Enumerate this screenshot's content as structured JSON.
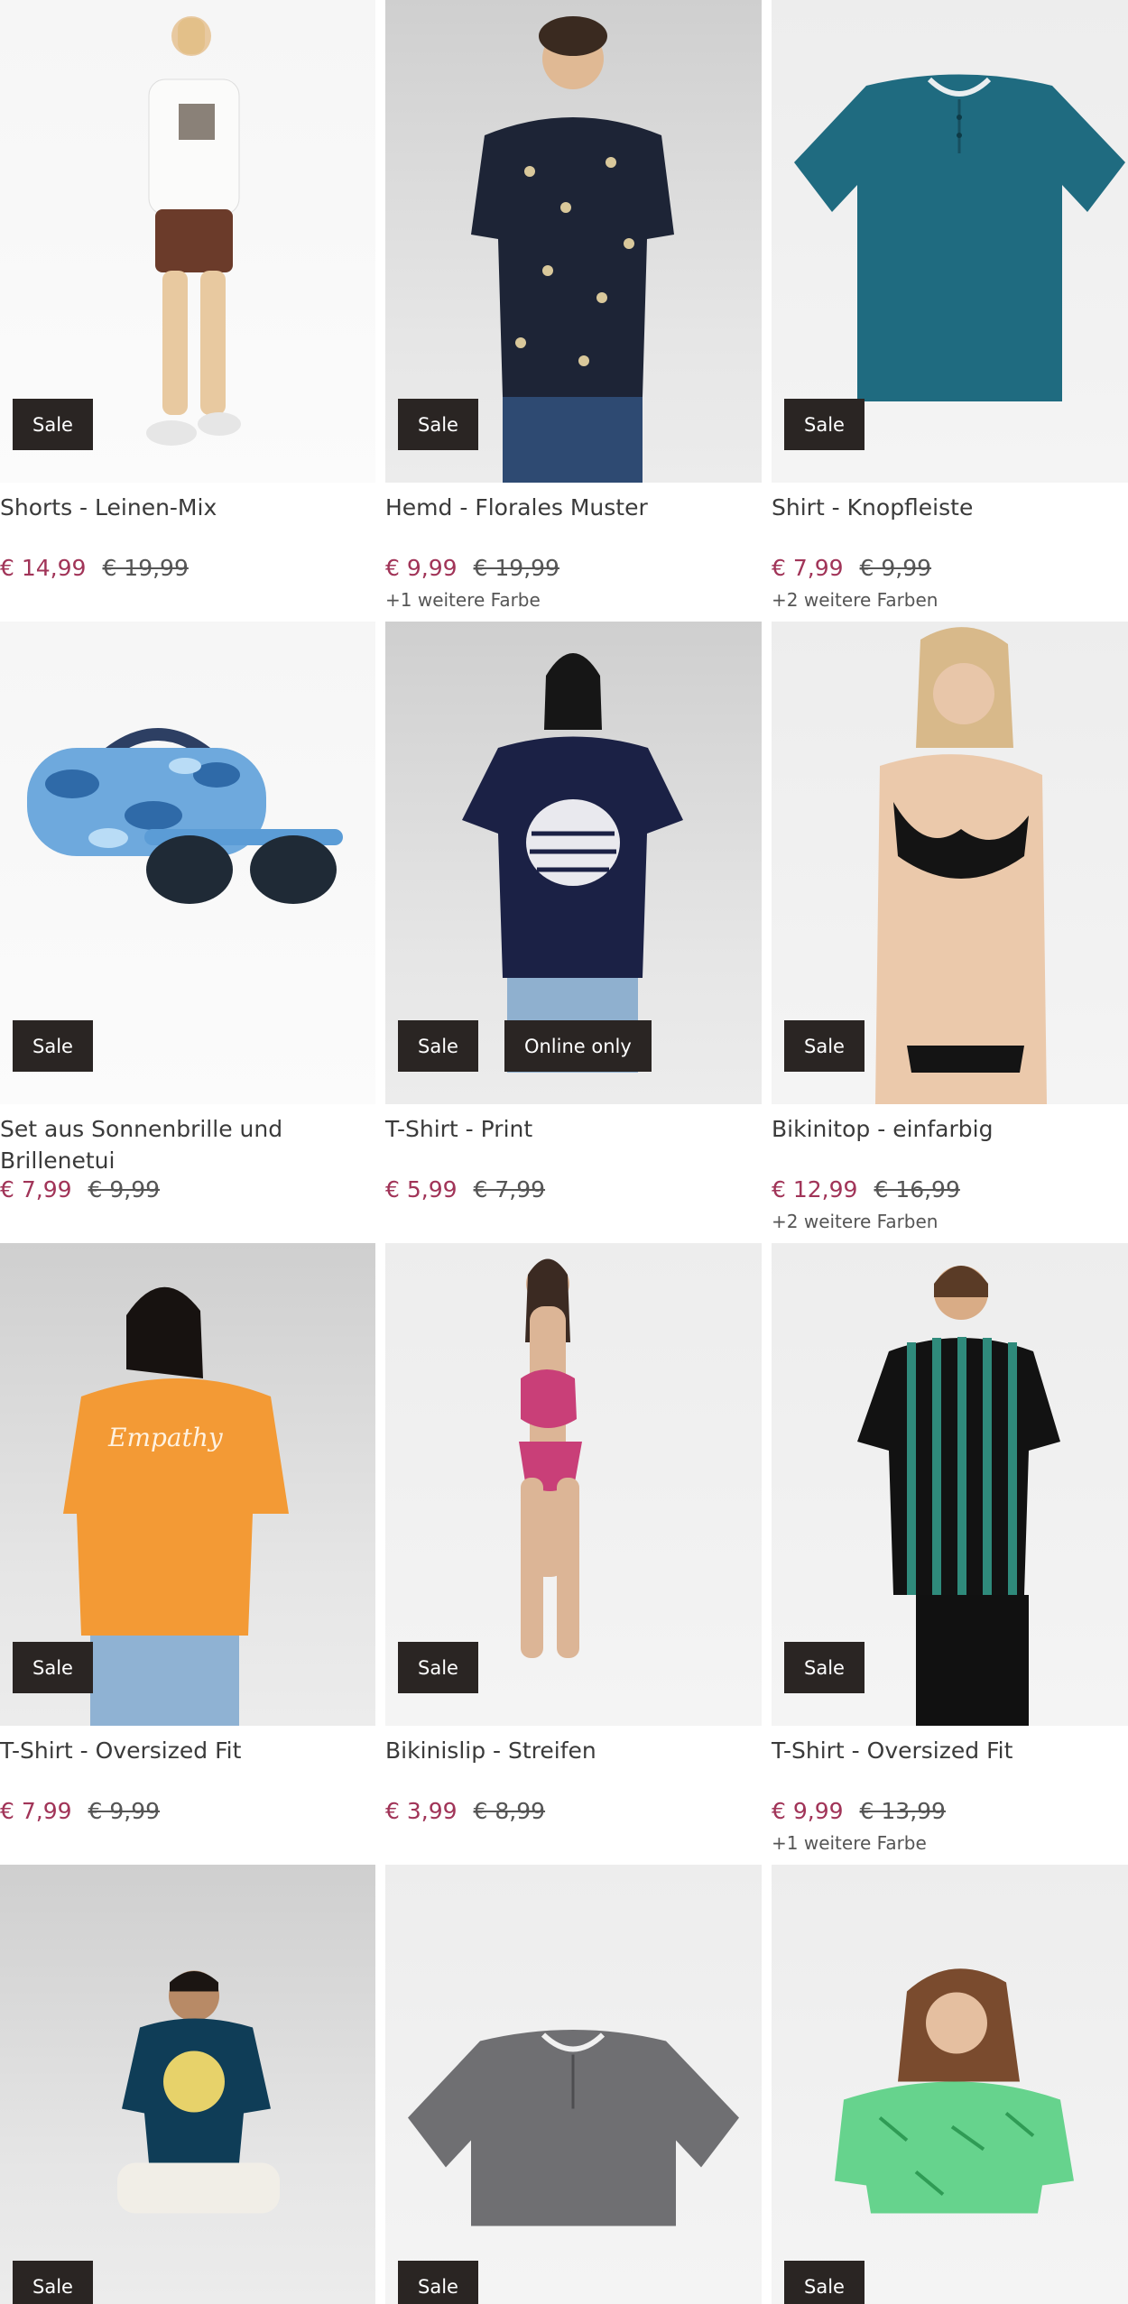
{
  "products": [
    {
      "title": "Shorts - Leinen-Mix",
      "price": "€ 14,99",
      "old_price": "€ 19,99",
      "colors": "",
      "badges": [
        "Sale"
      ],
      "image": "woman-white-tee-brown-shorts"
    },
    {
      "title": "Hemd - Florales Muster",
      "price": "€ 9,99",
      "old_price": "€ 19,99",
      "colors": "+1 weitere Farbe",
      "badges": [
        "Sale"
      ],
      "image": "man-floral-shirt"
    },
    {
      "title": "Shirt - Knopfleiste",
      "price": "€ 7,99",
      "old_price": "€ 9,99",
      "colors": "+2 weitere Farben",
      "badges": [
        "Sale"
      ],
      "image": "teal-henley-shirt"
    },
    {
      "title": "Set aus Sonnenbrille und Brillenetui",
      "price": "€ 7,99",
      "old_price": "€ 9,99",
      "colors": "",
      "badges": [
        "Sale"
      ],
      "image": "camo-sunglasses-case"
    },
    {
      "title": "T-Shirt - Print",
      "price": "€ 5,99",
      "old_price": "€ 7,99",
      "colors": "",
      "badges": [
        "Sale",
        "Online only"
      ],
      "image": "woman-navy-print-tee"
    },
    {
      "title": "Bikinitop - einfarbig",
      "price": "€ 12,99",
      "old_price": "€ 16,99",
      "colors": "+2 weitere Farben",
      "badges": [
        "Sale"
      ],
      "image": "woman-black-bikini"
    },
    {
      "title": "T-Shirt - Oversized Fit",
      "price": "€ 7,99",
      "old_price": "€ 9,99",
      "colors": "",
      "badges": [
        "Sale"
      ],
      "image": "woman-orange-tee"
    },
    {
      "title": "Bikinislip - Streifen",
      "price": "€ 3,99",
      "old_price": "€ 8,99",
      "colors": "",
      "badges": [
        "Sale"
      ],
      "image": "woman-pink-bikini"
    },
    {
      "title": "T-Shirt - Oversized Fit",
      "price": "€ 9,99",
      "old_price": "€ 13,99",
      "colors": "+1 weitere Farbe",
      "badges": [
        "Sale"
      ],
      "image": "man-striped-tee"
    },
    {
      "title": "",
      "price": "",
      "old_price": "",
      "colors": "",
      "badges": [
        "Sale"
      ],
      "image": "man-print-tee-stool"
    },
    {
      "title": "",
      "price": "",
      "old_price": "",
      "colors": "",
      "badges": [
        "Sale"
      ],
      "image": "grey-henley-shirt"
    },
    {
      "title": "",
      "price": "",
      "old_price": "",
      "colors": "",
      "badges": [
        "Sale"
      ],
      "image": "woman-green-leaf-tee"
    }
  ],
  "colors": {
    "sale_price": "#a13458",
    "badge_bg": "#2a2523"
  }
}
